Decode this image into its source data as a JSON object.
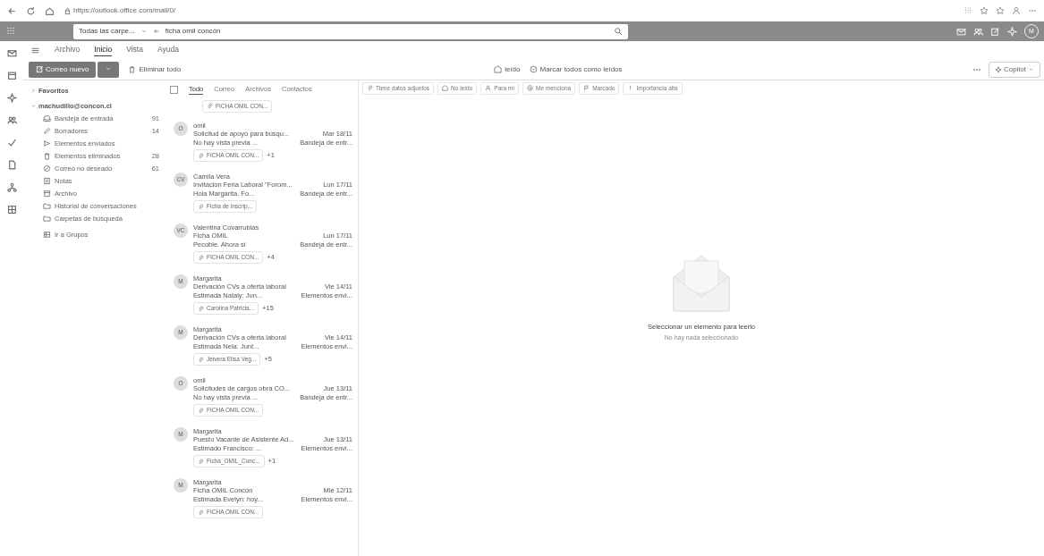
{
  "browser": {
    "url": "https://outlook.office.com/mail/0/"
  },
  "search": {
    "scope": "Todas las carpe...",
    "query": "ficha omil concón"
  },
  "account_avatar": "M",
  "ribbon_tabs": [
    {
      "label": "Archivo",
      "selected": false
    },
    {
      "label": "Inicio",
      "selected": true
    },
    {
      "label": "Vista",
      "selected": false
    },
    {
      "label": "Ayuda",
      "selected": false
    }
  ],
  "toolbar": {
    "new_mail": "Correo nuevo",
    "delete_all": "Eliminar todo",
    "read": "leído",
    "mark_all_read": "Marcar todos como leídos",
    "copilot": "Copilot"
  },
  "folders": {
    "favorites": "Favoritos",
    "account": "machudillo@concon.cl",
    "items": [
      {
        "kind": "inbox",
        "label": "Bandeja de entrada",
        "count": "91"
      },
      {
        "kind": "drafts",
        "label": "Borradores",
        "count": "14"
      },
      {
        "kind": "sent",
        "label": "Elementos enviados"
      },
      {
        "kind": "deleted",
        "label": "Elementos eliminados",
        "count": "28"
      },
      {
        "kind": "junk",
        "label": "Correo no deseado",
        "count": "61"
      },
      {
        "kind": "notes",
        "label": "Notas"
      },
      {
        "kind": "archive",
        "label": "Archivo"
      },
      {
        "kind": "history",
        "label": "Historial de conversaciones"
      },
      {
        "kind": "search",
        "label": "Carpetas de búsqueda"
      }
    ],
    "groups": "Ir a Grupos"
  },
  "select_all": {
    "checked": false
  },
  "list_tabs": [
    {
      "label": "Todo",
      "selected": true
    },
    {
      "label": "Correo",
      "selected": false
    },
    {
      "label": "Archivos",
      "selected": false
    },
    {
      "label": "Contactos",
      "selected": false
    }
  ],
  "top_chip": "FICHA OMIL CON...",
  "messages": [
    {
      "initials": "O",
      "sender": "omil",
      "subject": "Solicitud de apoyo para búsqu...",
      "date": "Mar 18/11",
      "preview": "No hay vista previa ...",
      "folder": "Bandeja de entr...",
      "attachment": "FICHA OMIL CON...",
      "extra": "+1"
    },
    {
      "initials": "CV",
      "sender": "Camila Vera",
      "subject": "Invitación Feria Laboral \"Forom...",
      "date": "Lun 17/11",
      "preview": "Hola Margarita. Fo...",
      "folder": "Bandeja de entr...",
      "attachment": "Ficha de inscrip..."
    },
    {
      "initials": "VC",
      "sender": "Valentina Covarrubias",
      "subject": "Ficha OMIL",
      "date": "Lun 17/11",
      "preview": "Pecoble. Ahora si",
      "folder": "Bandeja de entr...",
      "attachment": "FICHA OMIL CON...",
      "extra": "+4"
    },
    {
      "initials": "M",
      "sender": "Margarita",
      "subject": "Derivación CVs a oferta laboral",
      "date": "Vie 14/11",
      "preview": "Estimada Nataly: Jun...",
      "folder": "Elementos envi...",
      "attachment": "Carolina Patricia...",
      "extra": "+15"
    },
    {
      "initials": "M",
      "sender": "Margarita",
      "subject": "Derivación CVs a oferta laboral",
      "date": "Vie 14/11",
      "preview": "Estimada Nela: Junt...",
      "folder": "Elementos envi...",
      "attachment": "Jeivera Elisa Veg...",
      "extra": "+5"
    },
    {
      "initials": "O",
      "sender": "omil",
      "subject": "Solicitudes de cargos obra CO...",
      "date": "Jue 13/11",
      "preview": "No hay vista previa ...",
      "folder": "Bandeja de entr...",
      "attachment": "FICHA OMIL CON..."
    },
    {
      "initials": "M",
      "sender": "Margarita",
      "subject": "Puesto Vacante de Asistente Ad...",
      "date": "Jue 13/11",
      "preview": "Estimado Francisco: ...",
      "folder": "Elementos envi...",
      "attachment": "Ficha_OMIL_Conc...",
      "extra": "+1"
    },
    {
      "initials": "M",
      "sender": "Margarita",
      "subject": "Ficha OMIL Concón",
      "date": "Mié 12/11",
      "preview": "Estimada Evelyn: hoy...",
      "folder": "Elementos envi...",
      "attachment": "FICHA OMIL CON..."
    }
  ],
  "filters": [
    "Tiene datos adjuntos",
    "No leído",
    "Para mí",
    "Me menciona",
    "Marcado",
    "Importancia alta"
  ],
  "reading_pane": {
    "title": "Seleccionar un elemento para leerlo",
    "subtitle": "No hay nada seleccionado"
  }
}
